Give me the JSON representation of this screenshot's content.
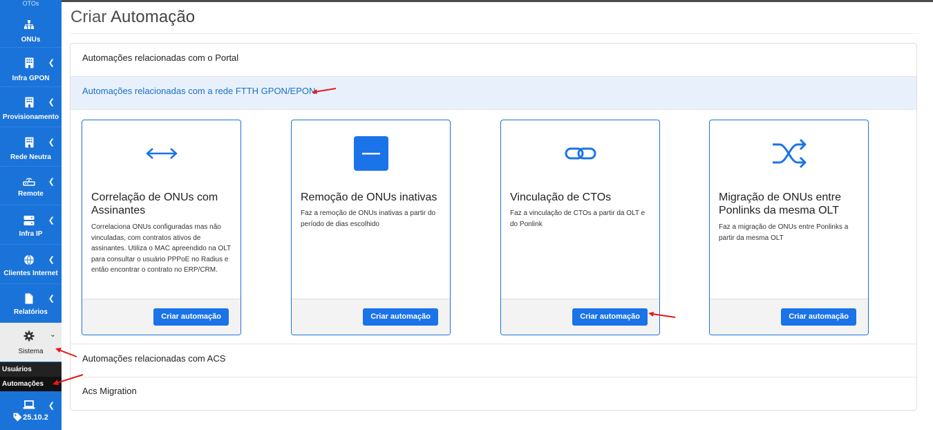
{
  "sidebar": {
    "top_cut_label": "OTOs",
    "items": [
      {
        "label": "ONUs",
        "icon": "sitemap-icon"
      },
      {
        "label": "Infra GPON",
        "icon": "building-icon"
      },
      {
        "label": "Provisionamento",
        "icon": "building-icon"
      },
      {
        "label": "Rede Neutra",
        "icon": "building-icon"
      },
      {
        "label": "Remote",
        "icon": "router-icon"
      },
      {
        "label": "Infra IP",
        "icon": "server-icon"
      },
      {
        "label": "Clientes Internet",
        "icon": "globe-icon"
      },
      {
        "label": "Relatórios",
        "icon": "file-icon"
      }
    ],
    "sistema": {
      "label": "Sistema",
      "icon": "gear-icon"
    },
    "submenu": [
      {
        "label": "Usuários"
      },
      {
        "label": "Automações"
      }
    ],
    "version": "25.10.2"
  },
  "page": {
    "title_light": "Criar",
    "title_strong": "Automação"
  },
  "accordion": {
    "portal": "Automações relacionadas com o Portal",
    "ftth": "Automações relacionadas com a rede FTTH GPON/EPON",
    "acs": "Automações relacionadas com ACS",
    "acs_migration": "Acs Migration"
  },
  "cards": [
    {
      "icon": "arrows-horizontal-icon",
      "title": "Correlação de ONUs com Assinantes",
      "description": "Correlaciona ONUs configuradas mas não vinculadas, com contratos ativos de assinantes. Utiliza o MAC apreendido na OLT para consultar o usuário PPPoE no Radius e então encontrar o contrato no ERP/CRM.",
      "button": "Criar automação"
    },
    {
      "icon": "minus-square-icon",
      "title": "Remoção de ONUs inativas",
      "description": "Faz a remoção de ONUs inativas a partir do período de dias escolhido",
      "button": "Criar automação"
    },
    {
      "icon": "link-icon",
      "title": "Vinculação de CTOs",
      "description": "Faz a vinculação de CTOs a partir da OLT e do Ponlink",
      "button": "Criar automação"
    },
    {
      "icon": "shuffle-icon",
      "title": "Migração de ONUs entre Ponlinks da mesma OLT",
      "description": "Faz a migração de ONUs entre Ponlinks a partir da mesma OLT",
      "button": "Criar automação"
    }
  ],
  "colors": {
    "sidebar": "#1a73d9",
    "accent": "#1a73e8",
    "annotation_arrow": "#e3191c"
  }
}
